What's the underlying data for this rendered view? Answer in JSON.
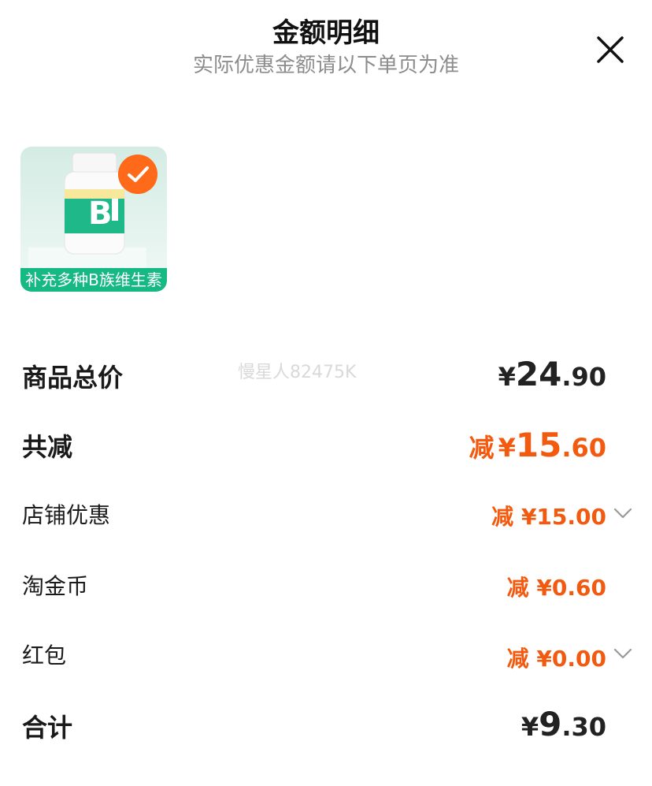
{
  "header": {
    "title": "金额明细",
    "subtitle": "实际优惠金额请以下单页为准"
  },
  "product": {
    "banner": "补充多种B族维生素"
  },
  "watermark": "慢星人82475K",
  "rows": {
    "total": {
      "label": "商品总价",
      "symbol": "¥",
      "int": "24",
      "dec": ".90"
    },
    "discount": {
      "label": "共减",
      "prefix": "减",
      "symbol": "¥",
      "int": "15",
      "dec": ".60"
    },
    "shop": {
      "label": "店铺优惠",
      "prefix": "减",
      "symbol": "¥",
      "int": "15",
      "dec": ".00"
    },
    "coins": {
      "label": "淘金币",
      "prefix": "减",
      "symbol": "¥",
      "int": "0",
      "dec": ".60"
    },
    "redpacket": {
      "label": "红包",
      "prefix": "减",
      "symbol": "¥",
      "int": "0",
      "dec": ".00"
    },
    "sum": {
      "label": "合计",
      "symbol": "¥",
      "int": "9",
      "dec": ".30"
    }
  },
  "colors": {
    "accent": "#f25a0f",
    "banner_green": "#16b883",
    "check_orange": "#ff6a1a"
  }
}
